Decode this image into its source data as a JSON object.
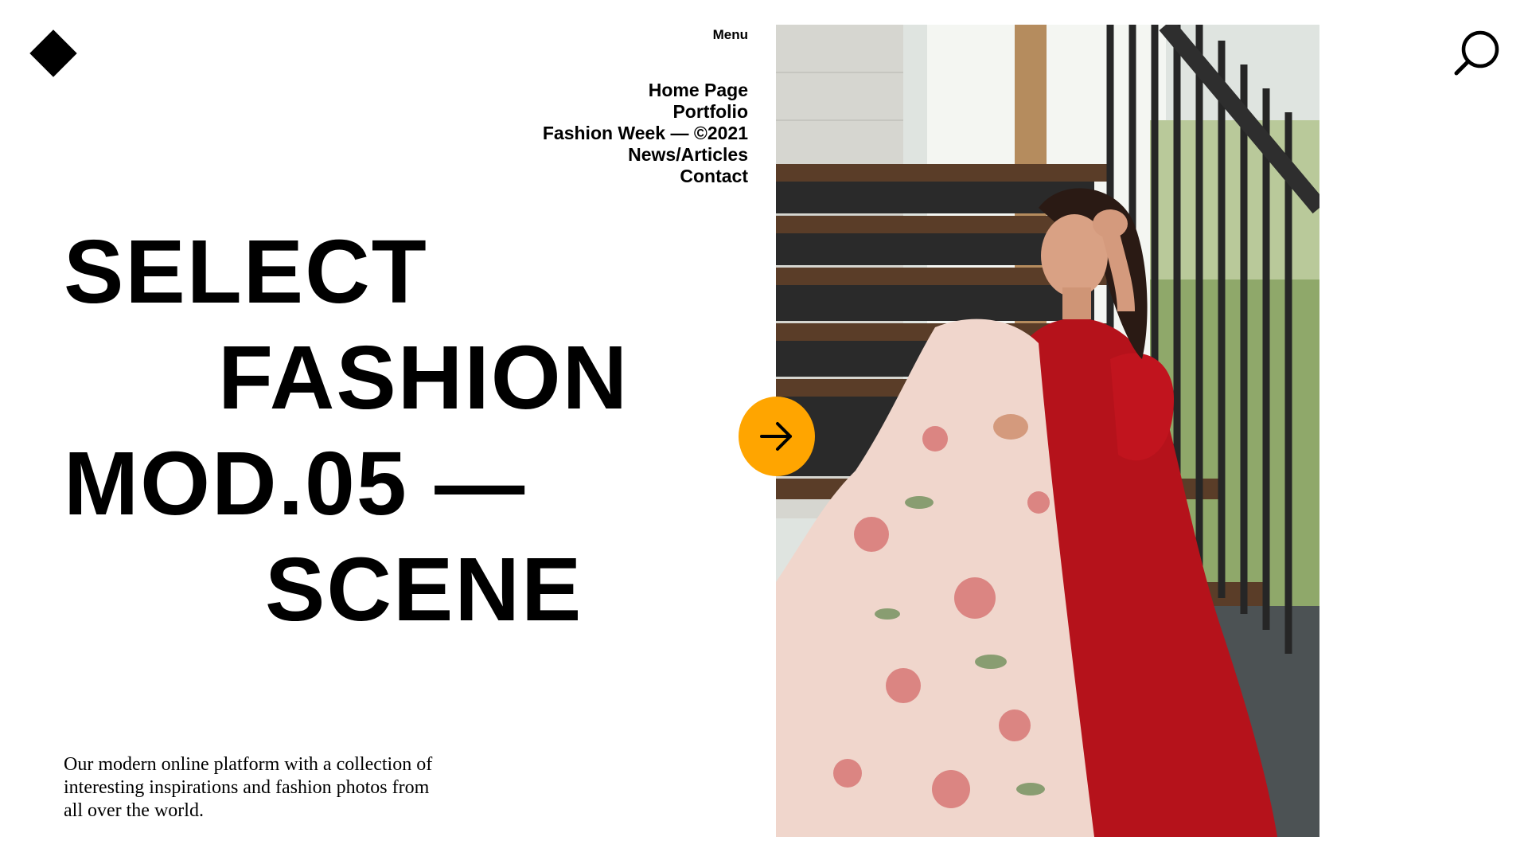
{
  "menu": {
    "label": "Menu",
    "items": [
      {
        "label": "Home Page"
      },
      {
        "label": "Portfolio"
      },
      {
        "label": "Fashion Week — ©2021"
      },
      {
        "label": "News/Articles"
      },
      {
        "label": "Contact"
      }
    ]
  },
  "hero": {
    "lines": [
      "SELECT",
      "FASHION",
      "MOD.05 —",
      "SCENE"
    ],
    "description": "Our modern online platform with a collection of interesting inspirations and fashion photos from all over the world."
  },
  "icons": {
    "logo": "diamond-logo",
    "next": "arrow-right-icon",
    "search": "search-icon"
  },
  "colors": {
    "accent": "#ffa500",
    "text": "#000000",
    "background": "#ffffff"
  }
}
